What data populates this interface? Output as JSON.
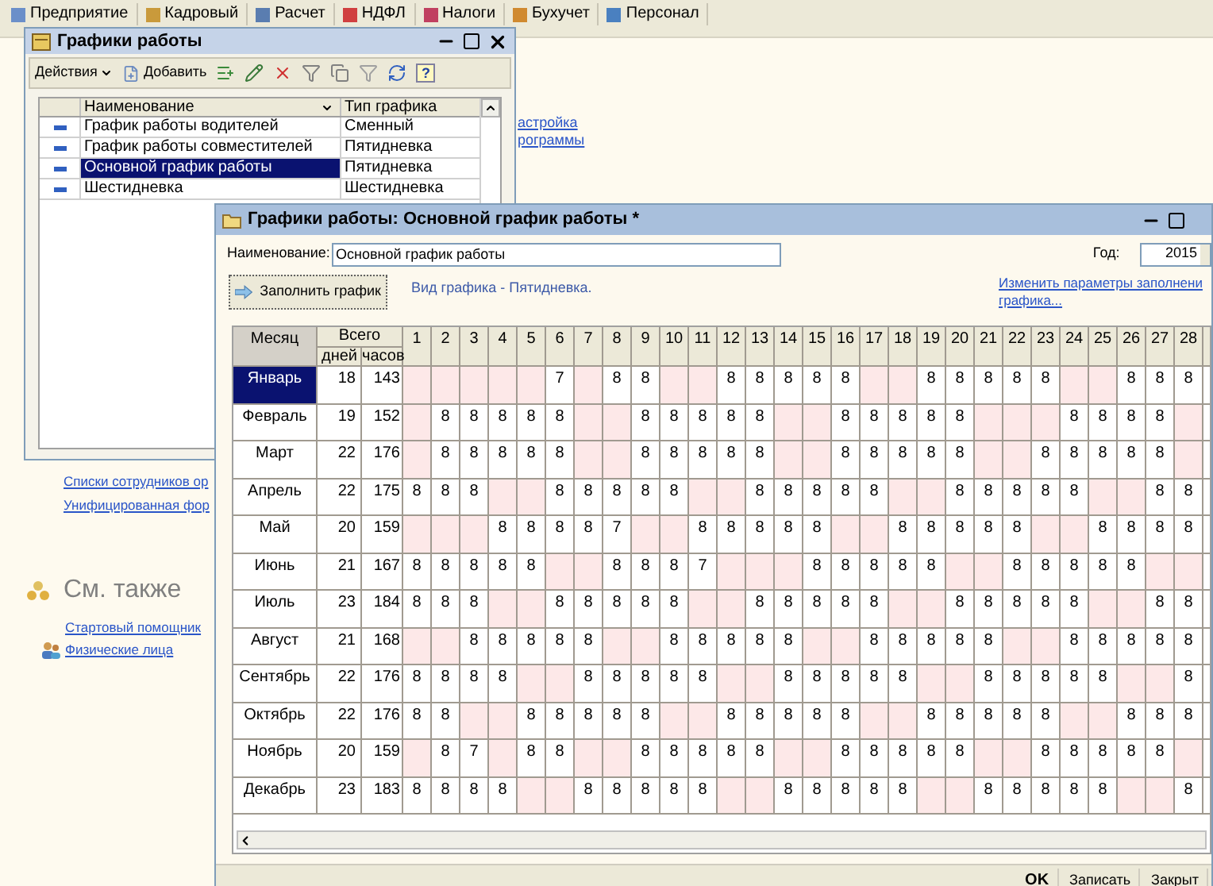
{
  "app_toolbar": {
    "tabs": [
      {
        "label": "Предприятие"
      },
      {
        "label": "Кадровый"
      },
      {
        "label": "Расчет"
      },
      {
        "label": "НДФЛ"
      },
      {
        "label": "Налоги"
      },
      {
        "label": "Бухучет"
      },
      {
        "label": "Персонал"
      }
    ]
  },
  "background_panel": {
    "links_top": [
      "астройка",
      "рограммы"
    ],
    "links": [
      "Списки сотрудников ор",
      "Унифицированная фор"
    ],
    "see_also": {
      "title": "См. также",
      "links": [
        {
          "label": "Стартовый помощник",
          "kind": "plain"
        },
        {
          "label": "Физические лица",
          "kind": "person"
        }
      ]
    }
  },
  "list_window": {
    "title": "Графики работы",
    "toolbar": {
      "actions": "Действия",
      "add": "Добавить",
      "help": "?"
    },
    "columns": [
      "Наименование",
      "Тип графика"
    ],
    "rows": [
      {
        "name": "График работы водителей",
        "type": "Сменный",
        "selected": false
      },
      {
        "name": "График работы совместителей",
        "type": "Пятидневка",
        "selected": false
      },
      {
        "name": "Основной график работы",
        "type": "Пятидневка",
        "selected": true
      },
      {
        "name": "Шестидневка",
        "type": "Шестидневка",
        "selected": false
      }
    ]
  },
  "form_window": {
    "title": "Графики работы: Основной график работы *",
    "name_label": "Наименование:",
    "name_value": "Основной график работы",
    "year_label": "Год:",
    "year_value": "2015",
    "fill_button": "Заполнить график",
    "schedule_kind": "Вид графика - Пятидневка.",
    "change_link": [
      "Изменить параметры заполнени",
      "графика..."
    ],
    "grid": {
      "month_header": "Месяц",
      "total_header": "Всего",
      "days_header": "дней",
      "hours_header": "часов",
      "day_numbers": [
        "1",
        "2",
        "3",
        "4",
        "5",
        "6",
        "7",
        "8",
        "9",
        "10",
        "11",
        "12",
        "13",
        "14",
        "15",
        "16",
        "17",
        "18",
        "19",
        "20",
        "21",
        "22",
        "23",
        "24",
        "25",
        "26",
        "27",
        "28"
      ],
      "months": [
        {
          "name": "Январь",
          "selected": true,
          "days_total": "18",
          "hours_total": "143",
          "days": [
            {
              "off": true
            },
            {
              "off": true
            },
            {
              "off": true
            },
            {
              "off": true
            },
            {
              "off": true
            },
            {
              "value": "7",
              "off": false
            },
            {
              "off": true
            },
            {
              "value": "8",
              "off": false
            },
            {
              "value": "8",
              "off": false
            },
            {
              "off": true
            },
            {
              "off": true
            },
            {
              "value": "8",
              "off": false
            },
            {
              "value": "8",
              "off": false
            },
            {
              "value": "8",
              "off": false
            },
            {
              "value": "8",
              "off": false
            },
            {
              "value": "8",
              "off": false
            },
            {
              "off": true
            },
            {
              "off": true
            },
            {
              "value": "8",
              "off": false
            },
            {
              "value": "8",
              "off": false
            },
            {
              "value": "8",
              "off": false
            },
            {
              "value": "8",
              "off": false
            },
            {
              "value": "8",
              "off": false
            },
            {
              "off": true
            },
            {
              "off": true
            },
            {
              "value": "8",
              "off": false
            },
            {
              "value": "8",
              "off": false
            },
            {
              "value": "8",
              "off": false
            }
          ]
        },
        {
          "name": "Февраль",
          "selected": false,
          "days_total": "19",
          "hours_total": "152",
          "days": [
            {
              "off": true
            },
            {
              "value": "8",
              "off": false
            },
            {
              "value": "8",
              "off": false
            },
            {
              "value": "8",
              "off": false
            },
            {
              "value": "8",
              "off": false
            },
            {
              "value": "8",
              "off": false
            },
            {
              "off": true
            },
            {
              "off": true
            },
            {
              "value": "8",
              "off": false
            },
            {
              "value": "8",
              "off": false
            },
            {
              "value": "8",
              "off": false
            },
            {
              "value": "8",
              "off": false
            },
            {
              "value": "8",
              "off": false
            },
            {
              "off": true
            },
            {
              "off": true
            },
            {
              "value": "8",
              "off": false
            },
            {
              "value": "8",
              "off": false
            },
            {
              "value": "8",
              "off": false
            },
            {
              "value": "8",
              "off": false
            },
            {
              "value": "8",
              "off": false
            },
            {
              "off": true
            },
            {
              "off": true
            },
            {
              "off": true
            },
            {
              "value": "8",
              "off": false
            },
            {
              "value": "8",
              "off": false
            },
            {
              "value": "8",
              "off": false
            },
            {
              "value": "8",
              "off": false
            },
            {
              "off": true
            }
          ]
        },
        {
          "name": "Март",
          "selected": false,
          "days_total": "22",
          "hours_total": "176",
          "days": [
            {
              "off": true
            },
            {
              "value": "8",
              "off": false
            },
            {
              "value": "8",
              "off": false
            },
            {
              "value": "8",
              "off": false
            },
            {
              "value": "8",
              "off": false
            },
            {
              "value": "8",
              "off": false
            },
            {
              "off": true
            },
            {
              "off": true
            },
            {
              "value": "8",
              "off": false
            },
            {
              "value": "8",
              "off": false
            },
            {
              "value": "8",
              "off": false
            },
            {
              "value": "8",
              "off": false
            },
            {
              "value": "8",
              "off": false
            },
            {
              "off": true
            },
            {
              "off": true
            },
            {
              "value": "8",
              "off": false
            },
            {
              "value": "8",
              "off": false
            },
            {
              "value": "8",
              "off": false
            },
            {
              "value": "8",
              "off": false
            },
            {
              "value": "8",
              "off": false
            },
            {
              "off": true
            },
            {
              "off": true
            },
            {
              "value": "8",
              "off": false
            },
            {
              "value": "8",
              "off": false
            },
            {
              "value": "8",
              "off": false
            },
            {
              "value": "8",
              "off": false
            },
            {
              "value": "8",
              "off": false
            },
            {
              "off": true
            }
          ]
        },
        {
          "name": "Апрель",
          "selected": false,
          "days_total": "22",
          "hours_total": "175",
          "days": [
            {
              "value": "8",
              "off": false
            },
            {
              "value": "8",
              "off": false
            },
            {
              "value": "8",
              "off": false
            },
            {
              "off": true
            },
            {
              "off": true
            },
            {
              "value": "8",
              "off": false
            },
            {
              "value": "8",
              "off": false
            },
            {
              "value": "8",
              "off": false
            },
            {
              "value": "8",
              "off": false
            },
            {
              "value": "8",
              "off": false
            },
            {
              "off": true
            },
            {
              "off": true
            },
            {
              "value": "8",
              "off": false
            },
            {
              "value": "8",
              "off": false
            },
            {
              "value": "8",
              "off": false
            },
            {
              "value": "8",
              "off": false
            },
            {
              "value": "8",
              "off": false
            },
            {
              "off": true
            },
            {
              "off": true
            },
            {
              "value": "8",
              "off": false
            },
            {
              "value": "8",
              "off": false
            },
            {
              "value": "8",
              "off": false
            },
            {
              "value": "8",
              "off": false
            },
            {
              "value": "8",
              "off": false
            },
            {
              "off": true
            },
            {
              "off": true
            },
            {
              "value": "8",
              "off": false
            },
            {
              "value": "8",
              "off": false
            }
          ]
        },
        {
          "name": "Май",
          "selected": false,
          "days_total": "20",
          "hours_total": "159",
          "days": [
            {
              "off": true
            },
            {
              "off": true
            },
            {
              "off": true
            },
            {
              "value": "8",
              "off": false
            },
            {
              "value": "8",
              "off": false
            },
            {
              "value": "8",
              "off": false
            },
            {
              "value": "8",
              "off": false
            },
            {
              "value": "7",
              "off": false
            },
            {
              "off": true
            },
            {
              "off": true
            },
            {
              "value": "8",
              "off": false
            },
            {
              "value": "8",
              "off": false
            },
            {
              "value": "8",
              "off": false
            },
            {
              "value": "8",
              "off": false
            },
            {
              "value": "8",
              "off": false
            },
            {
              "off": true
            },
            {
              "off": true
            },
            {
              "value": "8",
              "off": false
            },
            {
              "value": "8",
              "off": false
            },
            {
              "value": "8",
              "off": false
            },
            {
              "value": "8",
              "off": false
            },
            {
              "value": "8",
              "off": false
            },
            {
              "off": true
            },
            {
              "off": true
            },
            {
              "value": "8",
              "off": false
            },
            {
              "value": "8",
              "off": false
            },
            {
              "value": "8",
              "off": false
            },
            {
              "value": "8",
              "off": false
            }
          ]
        },
        {
          "name": "Июнь",
          "selected": false,
          "days_total": "21",
          "hours_total": "167",
          "days": [
            {
              "value": "8",
              "off": false
            },
            {
              "value": "8",
              "off": false
            },
            {
              "value": "8",
              "off": false
            },
            {
              "value": "8",
              "off": false
            },
            {
              "value": "8",
              "off": false
            },
            {
              "off": true
            },
            {
              "off": true
            },
            {
              "value": "8",
              "off": false
            },
            {
              "value": "8",
              "off": false
            },
            {
              "value": "8",
              "off": false
            },
            {
              "value": "7",
              "off": false
            },
            {
              "off": true
            },
            {
              "off": true
            },
            {
              "off": true
            },
            {
              "value": "8",
              "off": false
            },
            {
              "value": "8",
              "off": false
            },
            {
              "value": "8",
              "off": false
            },
            {
              "value": "8",
              "off": false
            },
            {
              "value": "8",
              "off": false
            },
            {
              "off": true
            },
            {
              "off": true
            },
            {
              "value": "8",
              "off": false
            },
            {
              "value": "8",
              "off": false
            },
            {
              "value": "8",
              "off": false
            },
            {
              "value": "8",
              "off": false
            },
            {
              "value": "8",
              "off": false
            },
            {
              "off": true
            },
            {
              "off": true
            }
          ]
        },
        {
          "name": "Июль",
          "selected": false,
          "days_total": "23",
          "hours_total": "184",
          "days": [
            {
              "value": "8",
              "off": false
            },
            {
              "value": "8",
              "off": false
            },
            {
              "value": "8",
              "off": false
            },
            {
              "off": true
            },
            {
              "off": true
            },
            {
              "value": "8",
              "off": false
            },
            {
              "value": "8",
              "off": false
            },
            {
              "value": "8",
              "off": false
            },
            {
              "value": "8",
              "off": false
            },
            {
              "value": "8",
              "off": false
            },
            {
              "off": true
            },
            {
              "off": true
            },
            {
              "value": "8",
              "off": false
            },
            {
              "value": "8",
              "off": false
            },
            {
              "value": "8",
              "off": false
            },
            {
              "value": "8",
              "off": false
            },
            {
              "value": "8",
              "off": false
            },
            {
              "off": true
            },
            {
              "off": true
            },
            {
              "value": "8",
              "off": false
            },
            {
              "value": "8",
              "off": false
            },
            {
              "value": "8",
              "off": false
            },
            {
              "value": "8",
              "off": false
            },
            {
              "value": "8",
              "off": false
            },
            {
              "off": true
            },
            {
              "off": true
            },
            {
              "value": "8",
              "off": false
            },
            {
              "value": "8",
              "off": false
            }
          ]
        },
        {
          "name": "Август",
          "selected": false,
          "days_total": "21",
          "hours_total": "168",
          "days": [
            {
              "off": true
            },
            {
              "off": true
            },
            {
              "value": "8",
              "off": false
            },
            {
              "value": "8",
              "off": false
            },
            {
              "value": "8",
              "off": false
            },
            {
              "value": "8",
              "off": false
            },
            {
              "value": "8",
              "off": false
            },
            {
              "off": true
            },
            {
              "off": true
            },
            {
              "value": "8",
              "off": false
            },
            {
              "value": "8",
              "off": false
            },
            {
              "value": "8",
              "off": false
            },
            {
              "value": "8",
              "off": false
            },
            {
              "value": "8",
              "off": false
            },
            {
              "off": true
            },
            {
              "off": true
            },
            {
              "value": "8",
              "off": false
            },
            {
              "value": "8",
              "off": false
            },
            {
              "value": "8",
              "off": false
            },
            {
              "value": "8",
              "off": false
            },
            {
              "value": "8",
              "off": false
            },
            {
              "off": true
            },
            {
              "off": true
            },
            {
              "value": "8",
              "off": false
            },
            {
              "value": "8",
              "off": false
            },
            {
              "value": "8",
              "off": false
            },
            {
              "value": "8",
              "off": false
            },
            {
              "value": "8",
              "off": false
            }
          ]
        },
        {
          "name": "Сентябрь",
          "selected": false,
          "days_total": "22",
          "hours_total": "176",
          "days": [
            {
              "value": "8",
              "off": false
            },
            {
              "value": "8",
              "off": false
            },
            {
              "value": "8",
              "off": false
            },
            {
              "value": "8",
              "off": false
            },
            {
              "off": true
            },
            {
              "off": true
            },
            {
              "value": "8",
              "off": false
            },
            {
              "value": "8",
              "off": false
            },
            {
              "value": "8",
              "off": false
            },
            {
              "value": "8",
              "off": false
            },
            {
              "value": "8",
              "off": false
            },
            {
              "off": true
            },
            {
              "off": true
            },
            {
              "value": "8",
              "off": false
            },
            {
              "value": "8",
              "off": false
            },
            {
              "value": "8",
              "off": false
            },
            {
              "value": "8",
              "off": false
            },
            {
              "value": "8",
              "off": false
            },
            {
              "off": true
            },
            {
              "off": true
            },
            {
              "value": "8",
              "off": false
            },
            {
              "value": "8",
              "off": false
            },
            {
              "value": "8",
              "off": false
            },
            {
              "value": "8",
              "off": false
            },
            {
              "value": "8",
              "off": false
            },
            {
              "off": true
            },
            {
              "off": true
            },
            {
              "value": "8",
              "off": false
            }
          ]
        },
        {
          "name": "Октябрь",
          "selected": false,
          "days_total": "22",
          "hours_total": "176",
          "days": [
            {
              "value": "8",
              "off": false
            },
            {
              "value": "8",
              "off": false
            },
            {
              "off": true
            },
            {
              "off": true
            },
            {
              "value": "8",
              "off": false
            },
            {
              "value": "8",
              "off": false
            },
            {
              "value": "8",
              "off": false
            },
            {
              "value": "8",
              "off": false
            },
            {
              "value": "8",
              "off": false
            },
            {
              "off": true
            },
            {
              "off": true
            },
            {
              "value": "8",
              "off": false
            },
            {
              "value": "8",
              "off": false
            },
            {
              "value": "8",
              "off": false
            },
            {
              "value": "8",
              "off": false
            },
            {
              "value": "8",
              "off": false
            },
            {
              "off": true
            },
            {
              "off": true
            },
            {
              "value": "8",
              "off": false
            },
            {
              "value": "8",
              "off": false
            },
            {
              "value": "8",
              "off": false
            },
            {
              "value": "8",
              "off": false
            },
            {
              "value": "8",
              "off": false
            },
            {
              "off": true
            },
            {
              "off": true
            },
            {
              "value": "8",
              "off": false
            },
            {
              "value": "8",
              "off": false
            },
            {
              "value": "8",
              "off": false
            }
          ]
        },
        {
          "name": "Ноябрь",
          "selected": false,
          "days_total": "20",
          "hours_total": "159",
          "days": [
            {
              "off": true
            },
            {
              "value": "8",
              "off": false
            },
            {
              "value": "7",
              "off": false
            },
            {
              "off": true
            },
            {
              "value": "8",
              "off": false
            },
            {
              "value": "8",
              "off": false
            },
            {
              "off": true
            },
            {
              "off": true
            },
            {
              "value": "8",
              "off": false
            },
            {
              "value": "8",
              "off": false
            },
            {
              "value": "8",
              "off": false
            },
            {
              "value": "8",
              "off": false
            },
            {
              "value": "8",
              "off": false
            },
            {
              "off": true
            },
            {
              "off": true
            },
            {
              "value": "8",
              "off": false
            },
            {
              "value": "8",
              "off": false
            },
            {
              "value": "8",
              "off": false
            },
            {
              "value": "8",
              "off": false
            },
            {
              "value": "8",
              "off": false
            },
            {
              "off": true
            },
            {
              "off": true
            },
            {
              "value": "8",
              "off": false
            },
            {
              "value": "8",
              "off": false
            },
            {
              "value": "8",
              "off": false
            },
            {
              "value": "8",
              "off": false
            },
            {
              "value": "8",
              "off": false
            },
            {
              "off": true
            }
          ]
        },
        {
          "name": "Декабрь",
          "selected": false,
          "days_total": "23",
          "hours_total": "183",
          "days": [
            {
              "value": "8",
              "off": false
            },
            {
              "value": "8",
              "off": false
            },
            {
              "value": "8",
              "off": false
            },
            {
              "value": "8",
              "off": false
            },
            {
              "off": true
            },
            {
              "off": true
            },
            {
              "value": "8",
              "off": false
            },
            {
              "value": "8",
              "off": false
            },
            {
              "value": "8",
              "off": false
            },
            {
              "value": "8",
              "off": false
            },
            {
              "value": "8",
              "off": false
            },
            {
              "off": true
            },
            {
              "off": true
            },
            {
              "value": "8",
              "off": false
            },
            {
              "value": "8",
              "off": false
            },
            {
              "value": "8",
              "off": false
            },
            {
              "value": "8",
              "off": false
            },
            {
              "value": "8",
              "off": false
            },
            {
              "off": true
            },
            {
              "off": true
            },
            {
              "value": "8",
              "off": false
            },
            {
              "value": "8",
              "off": false
            },
            {
              "value": "8",
              "off": false
            },
            {
              "value": "8",
              "off": false
            },
            {
              "value": "8",
              "off": false
            },
            {
              "off": true
            },
            {
              "off": true
            },
            {
              "value": "8",
              "off": false
            }
          ]
        }
      ]
    },
    "buttons": [
      "OK",
      "Записать",
      "Закрыт"
    ]
  }
}
